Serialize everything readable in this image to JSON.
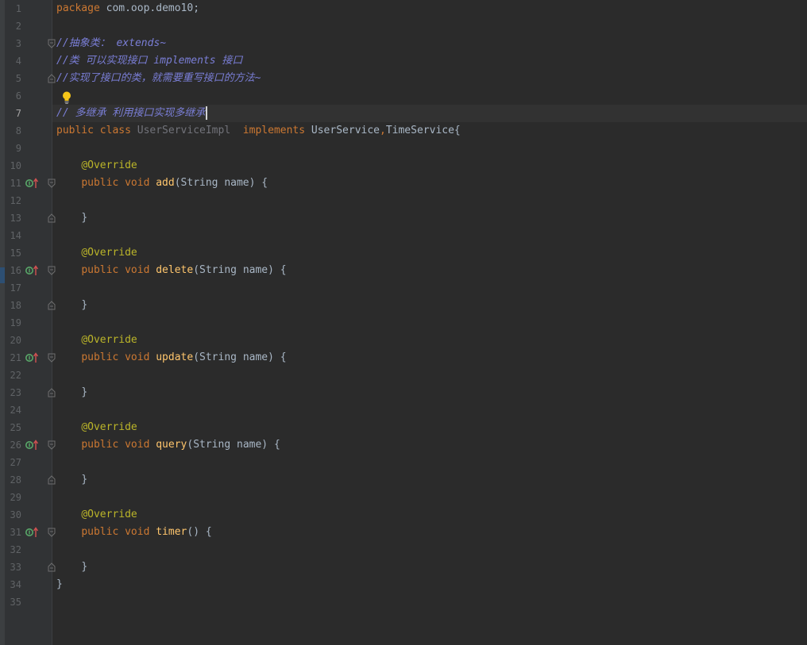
{
  "editor": {
    "line_numbers": [
      "1",
      "2",
      "3",
      "4",
      "5",
      "6",
      "7",
      "8",
      "9",
      "10",
      "11",
      "12",
      "13",
      "14",
      "15",
      "16",
      "17",
      "18",
      "19",
      "20",
      "21",
      "22",
      "23",
      "24",
      "25",
      "26",
      "27",
      "28",
      "29",
      "30",
      "31",
      "32",
      "33",
      "34",
      "35"
    ],
    "code": {
      "package_kw": "package",
      "package_name": " com.oop.demo10;",
      "comment_abstract": "//抽象类： extends~",
      "comment_interface": "//类 可以实现接口 implements 接口",
      "comment_override": "//实现了接口的类，就需要重写接口的方法~",
      "comment_multi": "// 多继承 利用接口实现多继承",
      "class_modifiers": "public class ",
      "class_name": "UserServiceImpl",
      "implements_kw": "  implements ",
      "interface_1": "UserService",
      "comma": ",",
      "interface_2": "TimeService{",
      "annotation": "@Override",
      "method_modifiers": "public void ",
      "methods": [
        {
          "name": "add",
          "params": "(String name) {"
        },
        {
          "name": "delete",
          "params": "(String name) {"
        },
        {
          "name": "update",
          "params": "(String name) {"
        },
        {
          "name": "query",
          "params": "(String name) {"
        },
        {
          "name": "timer",
          "params": "() {"
        }
      ],
      "method_close": "}",
      "class_close": "}"
    },
    "colors": {
      "background": "#2b2b2b",
      "gutter": "#313335",
      "keyword": "#cc7832",
      "comment": "#7a7ed6",
      "annotation": "#bbb529",
      "method": "#ffc66d",
      "text": "#a9b7c6",
      "unused": "#72737a"
    },
    "icons": {
      "implements_marker": "implements-method-icon",
      "fold_marker": "fold-icon",
      "intention_bulb": "lightbulb-icon"
    }
  }
}
